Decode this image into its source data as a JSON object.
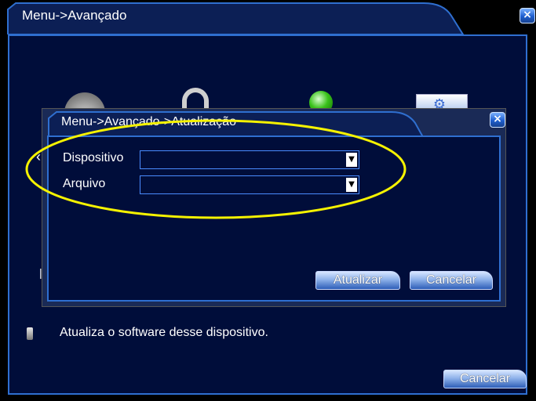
{
  "window": {
    "title": "Menu->Avançado",
    "close_glyph": "×",
    "cancel_label": "Cancelar"
  },
  "background_icons": [
    "disk-icon",
    "lock-icon",
    "globe-icon",
    "settings-icon"
  ],
  "dialog": {
    "title": "Menu->Avançado->Atualização",
    "close_glyph": "×",
    "fields": [
      {
        "label": "Dispositivo",
        "value": ""
      },
      {
        "label": "Arquivo",
        "value": ""
      }
    ],
    "update_label": "Atualizar",
    "cancel_label": "Cancelar"
  },
  "info": {
    "text": "Atualiza o software desse dispositivo."
  },
  "colors": {
    "background": "#000d3a",
    "border": "#2f6fd0",
    "highlight": "#f5f200"
  }
}
